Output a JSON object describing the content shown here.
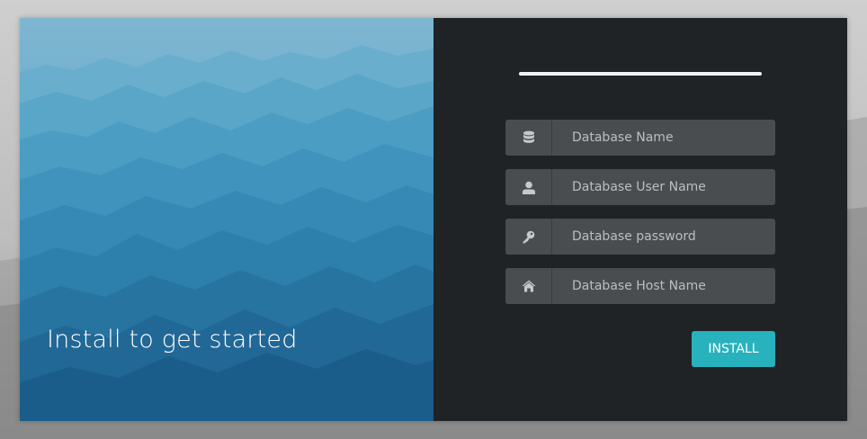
{
  "hero": {
    "tagline": "Install to get started"
  },
  "form": {
    "fields": [
      {
        "icon": "database-icon",
        "placeholder": "Database Name",
        "value": ""
      },
      {
        "icon": "user-icon",
        "placeholder": "Database User Name",
        "value": ""
      },
      {
        "icon": "key-icon",
        "placeholder": "Database password",
        "value": ""
      },
      {
        "icon": "home-icon",
        "placeholder": "Database Host Name",
        "value": ""
      }
    ],
    "install_label": "INSTALL"
  },
  "colors": {
    "accent": "#27b2bd",
    "panel": "#1f2326",
    "input_bg": "#4a4d50",
    "sky": "#2a8fb8"
  }
}
